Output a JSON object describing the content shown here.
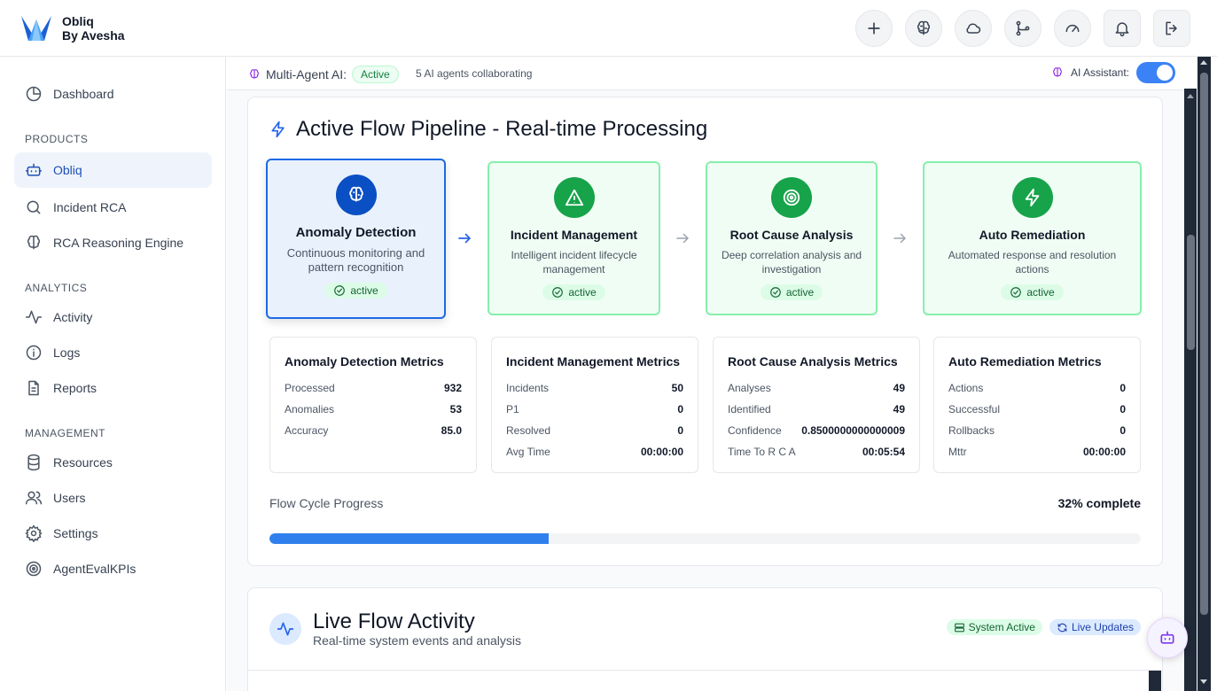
{
  "brand": {
    "line1": "Obliq",
    "line2": "By Avesha"
  },
  "top_icons": [
    "plus-icon",
    "brain-icon",
    "cloud-icon",
    "git-branch-icon",
    "gauge-icon",
    "bell-icon",
    "logout-icon"
  ],
  "sidebar": {
    "dashboard": "Dashboard",
    "sections": {
      "products": "PRODUCTS",
      "analytics": "ANALYTICS",
      "management": "MANAGEMENT"
    },
    "products": [
      {
        "label": "Obliq",
        "icon": "bot-icon",
        "active": true
      },
      {
        "label": "Incident RCA",
        "icon": "search-icon"
      },
      {
        "label": "RCA Reasoning Engine",
        "icon": "brain-icon"
      }
    ],
    "analytics": [
      {
        "label": "Activity",
        "icon": "activity-icon"
      },
      {
        "label": "Logs",
        "icon": "info-icon"
      },
      {
        "label": "Reports",
        "icon": "file-icon"
      }
    ],
    "management": [
      {
        "label": "Resources",
        "icon": "database-icon"
      },
      {
        "label": "Users",
        "icon": "users-icon"
      },
      {
        "label": "Settings",
        "icon": "gear-icon"
      },
      {
        "label": "AgentEvalKPIs",
        "icon": "target-icon"
      }
    ]
  },
  "status_strip": {
    "label": "Multi-Agent AI:",
    "status": "Active",
    "agents": "5 AI agents collaborating",
    "assistant_label": "AI Assistant:",
    "assistant_on": true
  },
  "pipeline": {
    "title": "Active Flow Pipeline - Real-time Processing",
    "stages": [
      {
        "name": "Anomaly Detection",
        "desc": "Continuous monitoring and pattern recognition",
        "status": "active",
        "icon": "brain-icon"
      },
      {
        "name": "Incident Management",
        "desc": "Intelligent incident lifecycle management",
        "status": "active",
        "icon": "alert-triangle-icon"
      },
      {
        "name": "Root Cause Analysis",
        "desc": "Deep correlation analysis and investigation",
        "status": "active",
        "icon": "target-icon"
      },
      {
        "name": "Auto Remediation",
        "desc": "Automated response and resolution actions",
        "status": "active",
        "icon": "zap-icon"
      }
    ],
    "metrics": [
      {
        "title": "Anomaly Detection Metrics",
        "rows": [
          [
            "Processed",
            "932"
          ],
          [
            "Anomalies",
            "53"
          ],
          [
            "Accuracy",
            "85.0"
          ]
        ]
      },
      {
        "title": "Incident Management Metrics",
        "rows": [
          [
            "Incidents",
            "50"
          ],
          [
            "P1",
            "0"
          ],
          [
            "Resolved",
            "0"
          ],
          [
            "Avg Time",
            "00:00:00"
          ]
        ]
      },
      {
        "title": "Root Cause Analysis Metrics",
        "rows": [
          [
            "Analyses",
            "49"
          ],
          [
            "Identified",
            "49"
          ],
          [
            "Confidence",
            "0.8500000000000009"
          ],
          [
            "Time To R C A",
            "00:05:54"
          ]
        ]
      },
      {
        "title": "Auto Remediation Metrics",
        "rows": [
          [
            "Actions",
            "0"
          ],
          [
            "Successful",
            "0"
          ],
          [
            "Rollbacks",
            "0"
          ],
          [
            "Mttr",
            "00:00:00"
          ]
        ]
      }
    ],
    "progress_label": "Flow Cycle Progress",
    "progress_text": "32% complete",
    "progress_value": 0.32
  },
  "live": {
    "title": "Live Flow Activity",
    "subtitle": "Real-time system events and analysis",
    "badge_system": "System Active",
    "badge_updates": "Live Updates"
  },
  "colors": {
    "accent": "#2f80ed",
    "active_green": "#16a34a",
    "current_blue": "#0a4fc4"
  }
}
